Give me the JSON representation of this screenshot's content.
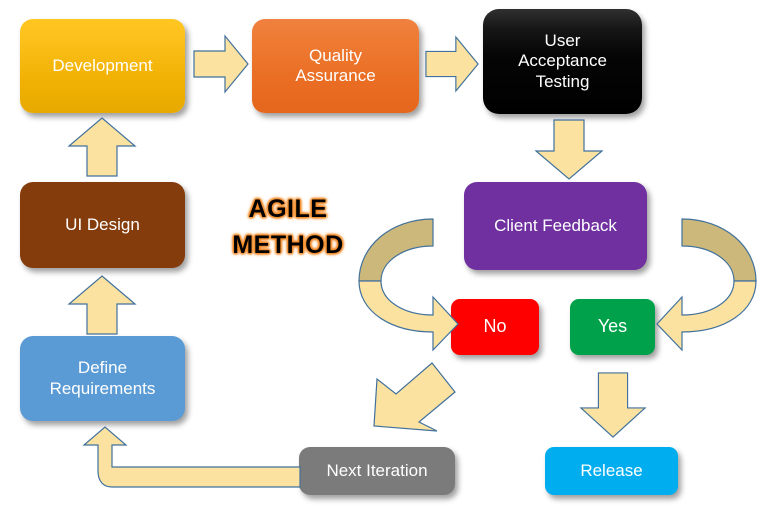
{
  "diagram": {
    "title_lines": [
      "AGILE",
      "METHOD"
    ],
    "title_color": "#000000",
    "title_glow_color": "#f28c28",
    "background": "#ffffff"
  },
  "nodes": [
    {
      "id": "development",
      "label": "Development",
      "color": "#f2b205",
      "text_color": "#ffffff"
    },
    {
      "id": "quality",
      "label": "Quality\nAssurance",
      "color": "#e96c22",
      "text_color": "#ffffff"
    },
    {
      "id": "uat",
      "label": "User\nAcceptance\nTesting",
      "color": "#000000",
      "text_color": "#ffffff"
    },
    {
      "id": "client_feedback",
      "label": "Client Feedback",
      "color": "#7030a0",
      "text_color": "#ffffff"
    },
    {
      "id": "ui_design",
      "label": "UI Design",
      "color": "#843c0c",
      "text_color": "#ffffff"
    },
    {
      "id": "define_req",
      "label": "Define\nRequirements",
      "color": "#5b9bd5",
      "text_color": "#ffffff"
    },
    {
      "id": "no",
      "label": "No",
      "color": "#fe0000",
      "text_color": "#ffffff"
    },
    {
      "id": "yes",
      "label": "Yes",
      "color": "#00a14b",
      "text_color": "#ffffff"
    },
    {
      "id": "next_iteration",
      "label": "Next Iteration",
      "color": "#7b7b7b",
      "text_color": "#ffffff"
    },
    {
      "id": "release",
      "label": "Release",
      "color": "#00adef",
      "text_color": "#ffffff"
    }
  ],
  "node_labels": {
    "development": "Development",
    "quality_line1": "Quality",
    "quality_line2": "Assurance",
    "uat_line1": "User",
    "uat_line2": "Acceptance",
    "uat_line3": "Testing",
    "client_feedback": "Client Feedback",
    "ui_design": "UI Design",
    "define_line1": "Define",
    "define_line2": "Requirements",
    "no": "No",
    "yes": "Yes",
    "next_iteration": "Next Iteration",
    "release": "Release"
  },
  "arrows": [
    {
      "id": "dev-to-qa",
      "from": "development",
      "to": "quality",
      "shape": "right-block-arrow",
      "color": "#fbe2a0"
    },
    {
      "id": "qa-to-uat",
      "from": "quality",
      "to": "uat",
      "shape": "right-block-arrow",
      "color": "#fbe2a0"
    },
    {
      "id": "uat-to-feedback",
      "from": "uat",
      "to": "client_feedback",
      "shape": "down-block-arrow",
      "color": "#fbe2a0"
    },
    {
      "id": "feedback-to-no",
      "from": "client_feedback",
      "to": "no",
      "shape": "curved-arrow-right",
      "color": "#fbe2a0"
    },
    {
      "id": "feedback-to-yes",
      "from": "client_feedback",
      "to": "yes",
      "shape": "curved-arrow-left",
      "color": "#fbe2a0"
    },
    {
      "id": "no-to-next",
      "from": "no",
      "to": "next_iteration",
      "shape": "diagonal-arrow",
      "color": "#fbe2a0"
    },
    {
      "id": "yes-to-release",
      "from": "yes",
      "to": "release",
      "shape": "down-block-arrow",
      "color": "#fbe2a0"
    },
    {
      "id": "next-to-define",
      "from": "next_iteration",
      "to": "define_req",
      "shape": "bent-elbow-arrow",
      "color": "#fbe2a0"
    },
    {
      "id": "define-to-ui",
      "from": "define_req",
      "to": "ui_design",
      "shape": "up-block-arrow",
      "color": "#fbe2a0"
    },
    {
      "id": "ui-to-dev",
      "from": "ui_design",
      "to": "development",
      "shape": "up-block-arrow",
      "color": "#fbe2a0"
    }
  ]
}
